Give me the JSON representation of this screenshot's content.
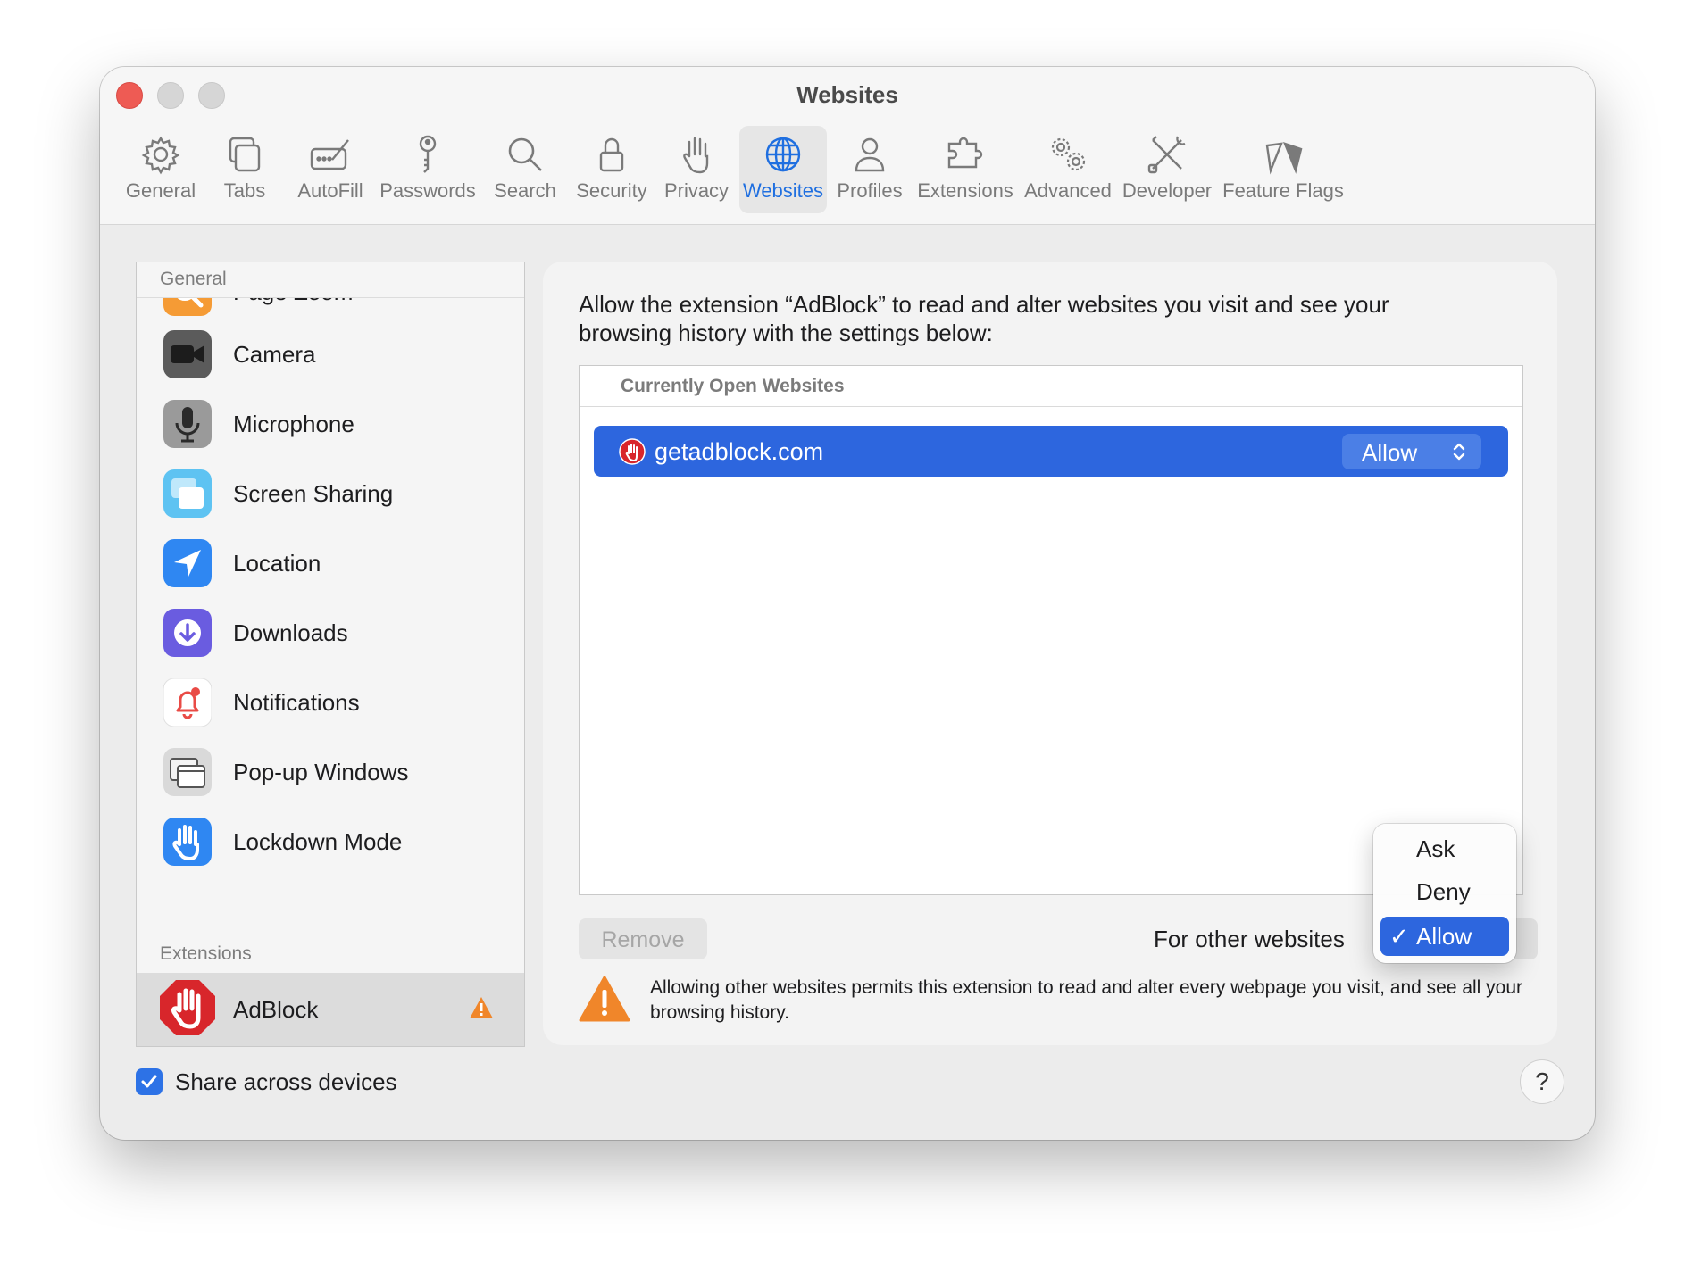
{
  "window": {
    "title": "Websites"
  },
  "toolbar": {
    "tabs": [
      {
        "label": "General",
        "icon": "gear-icon"
      },
      {
        "label": "Tabs",
        "icon": "tabs-icon"
      },
      {
        "label": "AutoFill",
        "icon": "autofill-icon"
      },
      {
        "label": "Passwords",
        "icon": "key-icon"
      },
      {
        "label": "Search",
        "icon": "search-icon"
      },
      {
        "label": "Security",
        "icon": "lock-icon"
      },
      {
        "label": "Privacy",
        "icon": "hand-icon"
      },
      {
        "label": "Websites",
        "icon": "globe-icon",
        "active": true
      },
      {
        "label": "Profiles",
        "icon": "person-icon"
      },
      {
        "label": "Extensions",
        "icon": "puzzle-icon"
      },
      {
        "label": "Advanced",
        "icon": "gears-icon"
      },
      {
        "label": "Developer",
        "icon": "tools-icon"
      },
      {
        "label": "Feature Flags",
        "icon": "flags-icon"
      }
    ]
  },
  "sidebar": {
    "general_header": "General",
    "items": [
      {
        "label": "Page Zoom",
        "icon": "page-zoom-icon"
      },
      {
        "label": "Camera",
        "icon": "camera-icon"
      },
      {
        "label": "Microphone",
        "icon": "microphone-icon"
      },
      {
        "label": "Screen Sharing",
        "icon": "screen-sharing-icon"
      },
      {
        "label": "Location",
        "icon": "location-icon"
      },
      {
        "label": "Downloads",
        "icon": "downloads-icon"
      },
      {
        "label": "Notifications",
        "icon": "notifications-icon"
      },
      {
        "label": "Pop-up Windows",
        "icon": "popup-windows-icon"
      },
      {
        "label": "Lockdown Mode",
        "icon": "lockdown-hand-icon"
      }
    ],
    "extensions_header": "Extensions",
    "extensions": [
      {
        "label": "AdBlock",
        "icon": "adblock-icon",
        "warning_icon": "warning-icon"
      }
    ]
  },
  "main": {
    "intro": "Allow the extension “AdBlock” to read and alter websites you visit and see your browsing history with the settings below:",
    "list_header": "Currently Open Websites",
    "sites": [
      {
        "name": "getadblock.com",
        "setting": "Allow"
      }
    ],
    "remove_label": "Remove",
    "other_websites_label": "For other websites",
    "warning_text": "Allowing other websites permits this extension to read and alter every webpage you visit, and see all your browsing history."
  },
  "popup": {
    "options": [
      "Ask",
      "Deny",
      "Allow"
    ],
    "selected": "Allow"
  },
  "footer": {
    "share_label": "Share across devices",
    "share_checked": true,
    "help_label": "?"
  },
  "colors": {
    "accent": "#2d66de",
    "close": "#ee5b54",
    "warning": "#f0862a",
    "adblock_red": "#d8262b"
  }
}
